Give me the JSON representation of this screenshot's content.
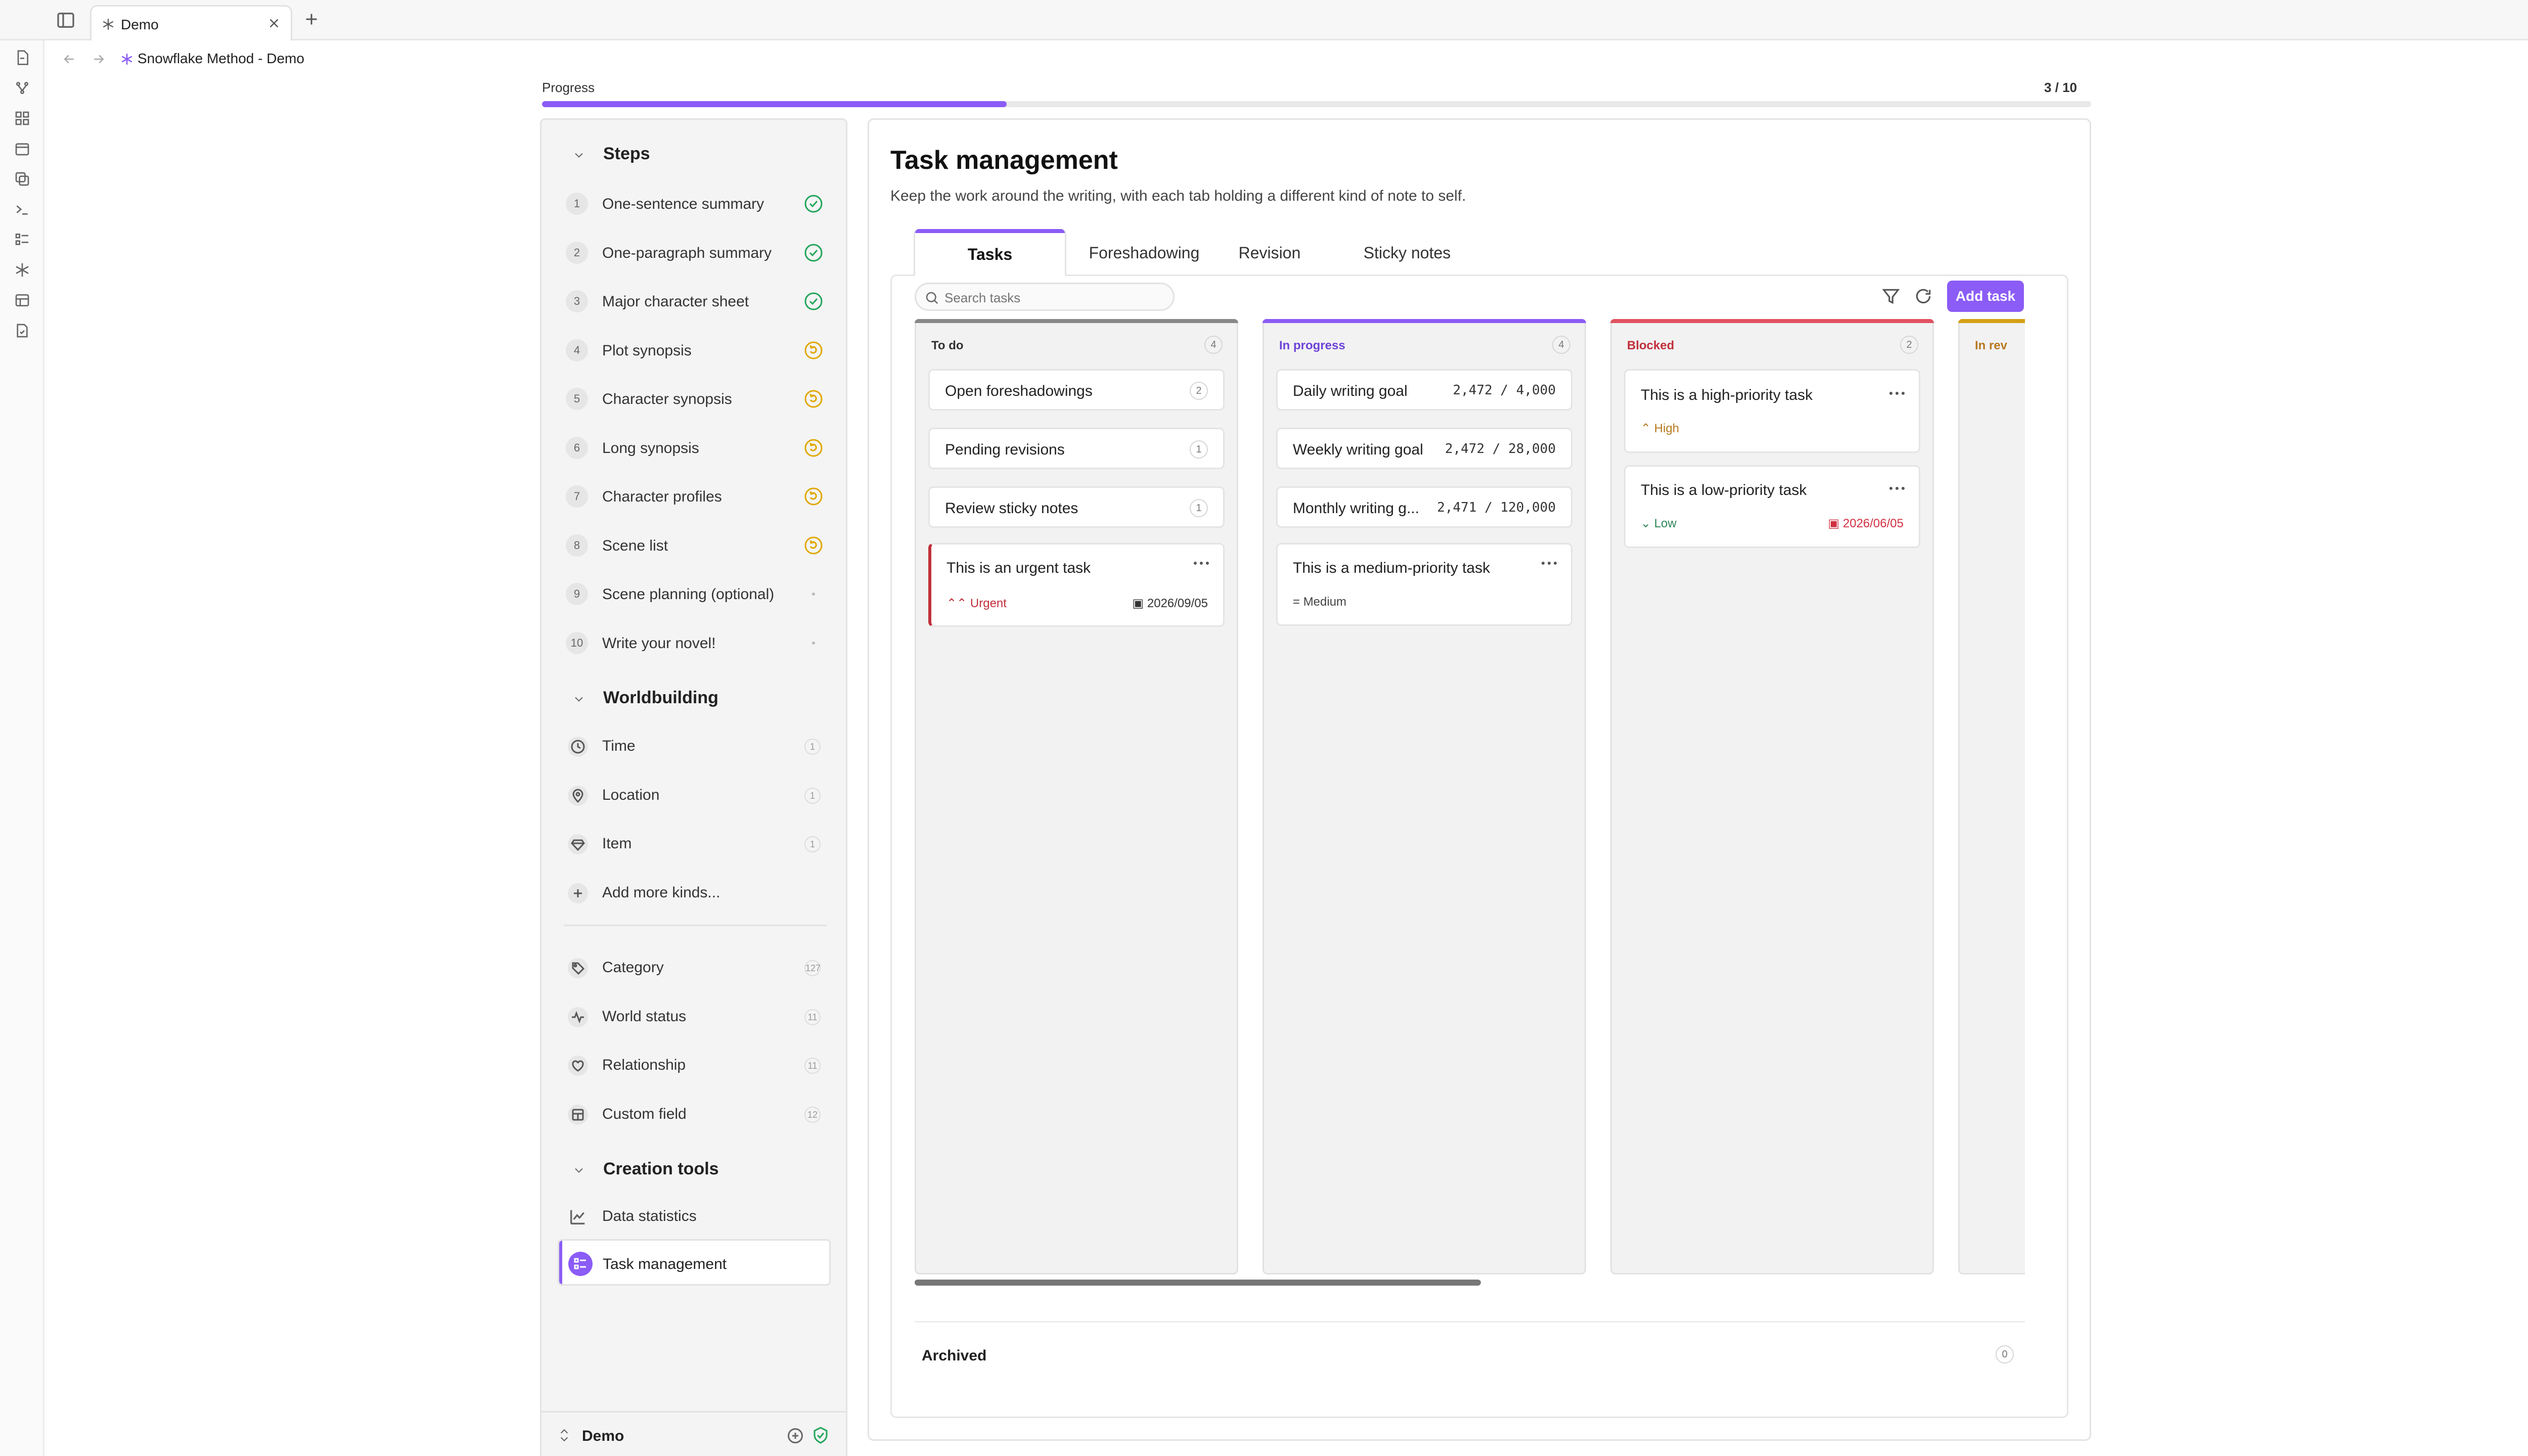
{
  "window": {
    "tab_title": "Demo",
    "breadcrumb": "Snowflake Method - Demo"
  },
  "progress": {
    "label": "Progress",
    "count": "3 / 10",
    "value": 0.3
  },
  "steps": {
    "title": "Steps",
    "items": [
      {
        "num": "1",
        "label": "One-sentence summary",
        "status": "done"
      },
      {
        "num": "2",
        "label": "One-paragraph summary",
        "status": "done"
      },
      {
        "num": "3",
        "label": "Major character sheet",
        "status": "done"
      },
      {
        "num": "4",
        "label": "Plot synopsis",
        "status": "in-progress"
      },
      {
        "num": "5",
        "label": "Character synopsis",
        "status": "in-progress"
      },
      {
        "num": "6",
        "label": "Long synopsis",
        "status": "in-progress"
      },
      {
        "num": "7",
        "label": "Character profiles",
        "status": "in-progress"
      },
      {
        "num": "8",
        "label": "Scene list",
        "status": "in-progress"
      },
      {
        "num": "9",
        "label": "Scene planning (optional)",
        "status": "todo"
      },
      {
        "num": "10",
        "label": "Write your novel!",
        "status": "todo"
      }
    ]
  },
  "worldbuilding": {
    "title": "Worldbuilding",
    "kinds": [
      {
        "label": "Time",
        "count": "1",
        "icon": "clock-icon"
      },
      {
        "label": "Location",
        "count": "1",
        "icon": "map-pin-icon"
      },
      {
        "label": "Item",
        "count": "1",
        "icon": "gem-icon"
      }
    ],
    "add_more": "Add more kinds...",
    "meta": [
      {
        "label": "Category",
        "count": "127",
        "icon": "tag-icon"
      },
      {
        "label": "World status",
        "count": "11",
        "icon": "activity-icon"
      },
      {
        "label": "Relationship",
        "count": "11",
        "icon": "heart-icon"
      },
      {
        "label": "Custom field",
        "count": "12",
        "icon": "layout-icon"
      }
    ]
  },
  "creation_tools": {
    "title": "Creation tools",
    "items": [
      {
        "label": "Data statistics",
        "icon": "chart-icon"
      },
      {
        "label": "Task management",
        "icon": "list-todo-icon",
        "active": true
      }
    ]
  },
  "footer": {
    "vault": "Demo"
  },
  "main": {
    "title": "Task management",
    "subtitle": "Keep the work around the writing, with each tab holding a different kind of note to self.",
    "tabs": [
      "Tasks",
      "Foreshadowing",
      "Revision",
      "Sticky notes"
    ],
    "active_tab": "Tasks",
    "search_placeholder": "Search tasks",
    "add_task": "Add task",
    "archived": {
      "label": "Archived",
      "count": "0"
    }
  },
  "board": {
    "columns": [
      {
        "title": "To do",
        "count": "4",
        "color": "#888888"
      },
      {
        "title": "In progress",
        "count": "4",
        "color": "#8b5cf6"
      },
      {
        "title": "Blocked",
        "count": "2",
        "color": "#e05260"
      },
      {
        "title": "In rev",
        "count": "",
        "color": "#d4a017"
      }
    ],
    "todo": {
      "auto": [
        {
          "title": "Open foreshadowings",
          "count": "2"
        },
        {
          "title": "Pending revisions",
          "count": "1"
        },
        {
          "title": "Review sticky notes",
          "count": "1"
        }
      ],
      "task": {
        "title": "This is an urgent task",
        "priority": "Urgent",
        "due": "2026/09/05"
      }
    },
    "in_progress": {
      "goals": [
        {
          "title": "Daily writing goal",
          "value": "2,472 / 4,000"
        },
        {
          "title": "Weekly writing goal",
          "value": "2,472 / 28,000"
        },
        {
          "title": "Monthly writing g...",
          "value": "2,471 / 120,000"
        }
      ],
      "task": {
        "title": "This is a medium-priority task",
        "priority": "Medium"
      }
    },
    "blocked": {
      "tasks": [
        {
          "title": "This is a high-priority task",
          "priority": "High"
        },
        {
          "title": "This is a low-priority task",
          "priority": "Low",
          "due": "2026/06/05"
        }
      ]
    }
  },
  "colors": {
    "accent": "#8b5cf6",
    "done": "#22a55a",
    "in_progress": "#e0a800",
    "urgent": "#c0303b",
    "high": "#b7791f",
    "low": "#2f855a",
    "due_red": "#d03040"
  }
}
